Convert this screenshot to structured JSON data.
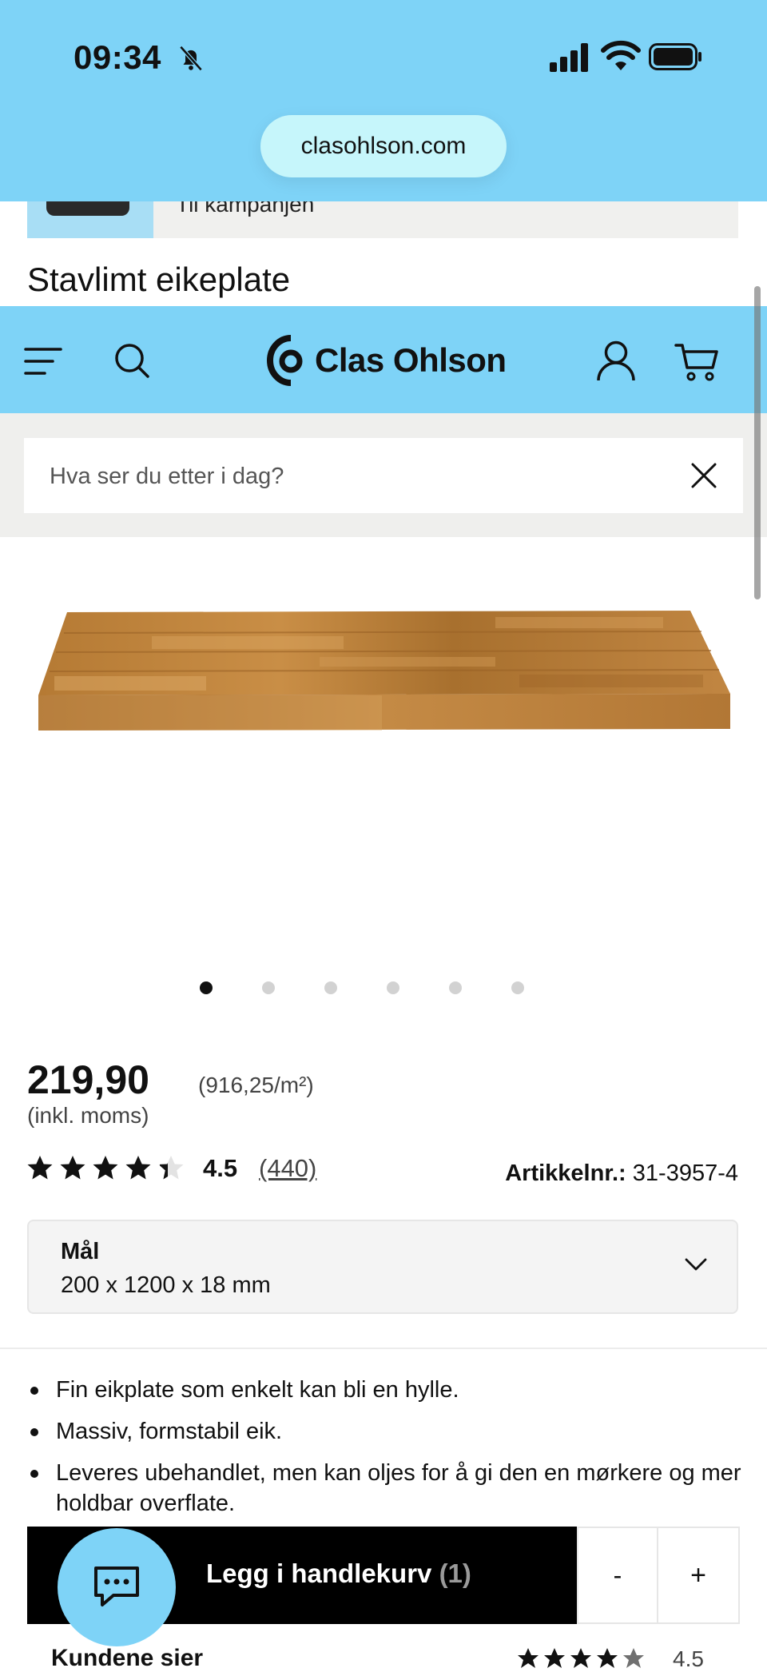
{
  "status_bar": {
    "time": "09:34",
    "icons": [
      "bell-slash-icon",
      "signal-icon",
      "wifi-icon",
      "battery-icon"
    ]
  },
  "browser": {
    "url": "clasohlson.com"
  },
  "campaign": {
    "link_text": "Til kampanjen"
  },
  "product": {
    "title": "Stavlimt eikeplate",
    "price": "219,90",
    "unit_price": "(916,25/m²)",
    "vat_note": "(inkl. moms)",
    "rating": "4.5",
    "rating_fraction": 0.9,
    "review_count": "(440)",
    "article_label": "Artikkelnr.:",
    "article_number": "31-3957-4",
    "image_count": 6,
    "active_image": 0,
    "bullets": [
      "Fin eikplate som enkelt kan bli en hylle.",
      "Massiv, formstabil eik.",
      "Leveres ubehandlet, men kan oljes for å gi den en mørkere og mer holdbar overflate."
    ]
  },
  "header": {
    "brand": "Clas Ohlson",
    "icons": [
      "menu-icon",
      "search-icon",
      "user-icon",
      "cart-icon"
    ]
  },
  "search": {
    "placeholder": "Hva ser du etter i dag?"
  },
  "size_select": {
    "label": "Mål",
    "value": "200 x 1200 x 18 mm"
  },
  "cart": {
    "button_label": "Legg i handlekurv",
    "count": "(1)",
    "minus": "-",
    "plus": "+"
  },
  "reviews": {
    "heading": "Kundene sier",
    "score": "4.5"
  },
  "colors": {
    "brand_blue": "#7ed3f7",
    "url_pill": "#c6f6fb",
    "dark": "#111111"
  }
}
